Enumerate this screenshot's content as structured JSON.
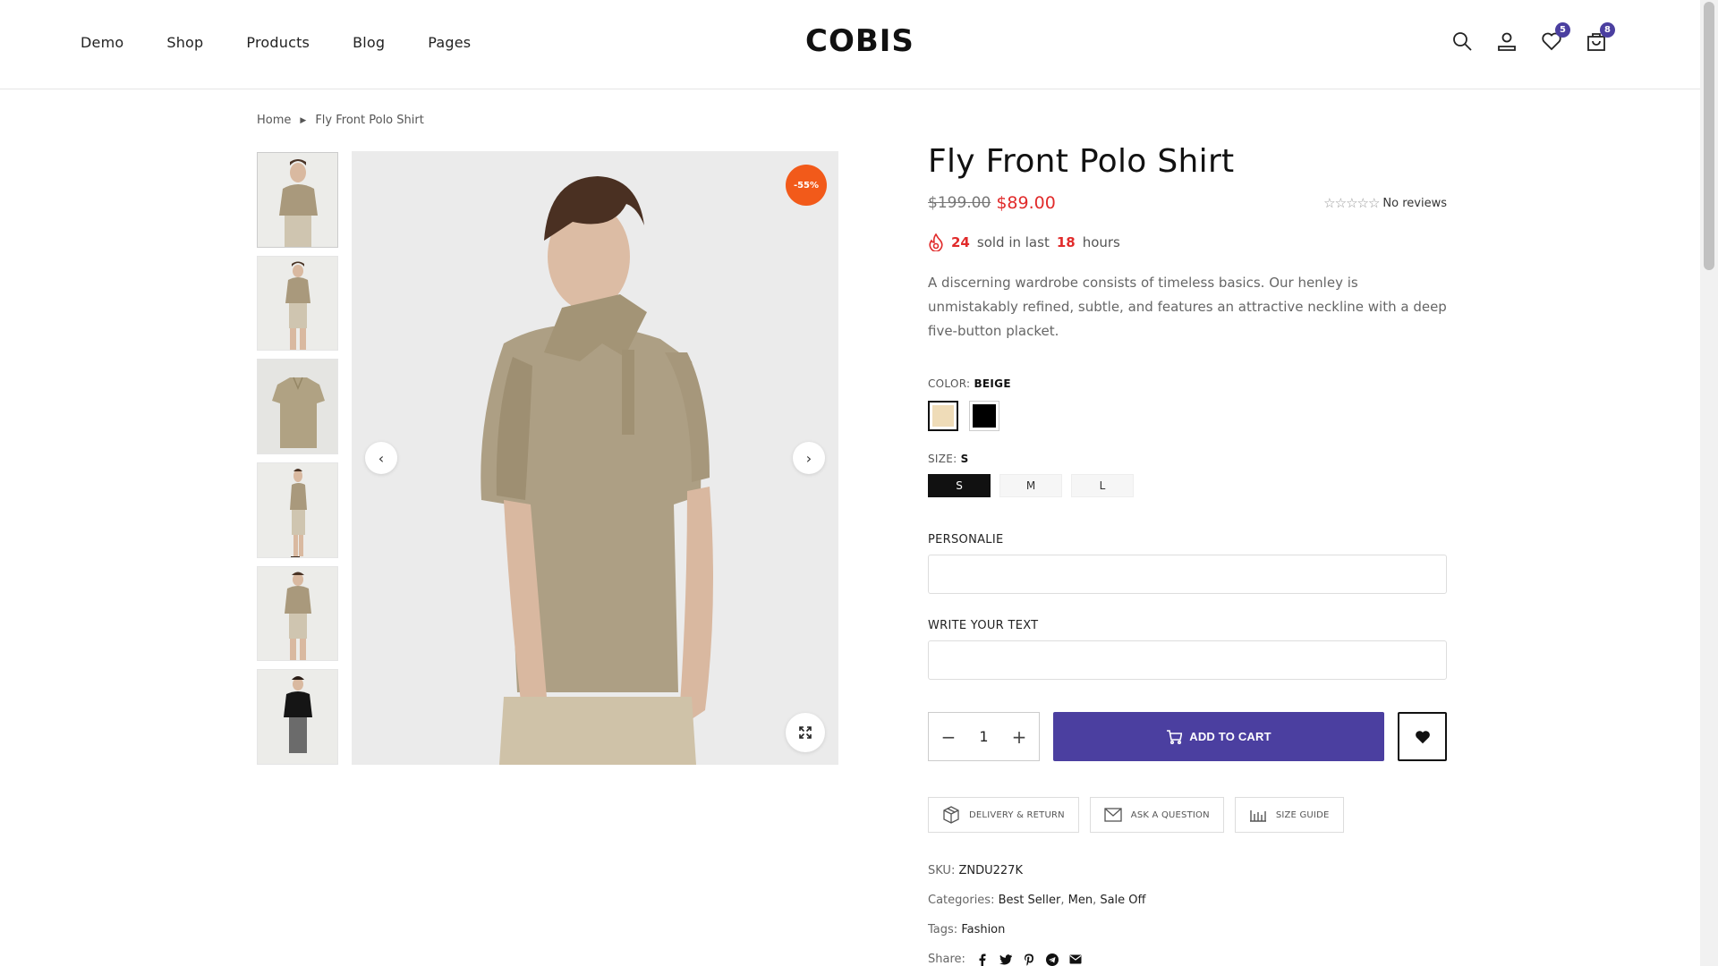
{
  "header": {
    "logo": "COBIS",
    "nav": [
      "Demo",
      "Shop",
      "Products",
      "Blog",
      "Pages"
    ],
    "wishlist_count": "5",
    "cart_count": "8"
  },
  "breadcrumb": {
    "home": "Home",
    "current": "Fly Front Polo Shirt"
  },
  "gallery": {
    "sale_badge": "-55%",
    "thumbnails": [
      "beige-front-half",
      "beige-front-full",
      "beige-flat",
      "beige-side",
      "beige-front-full-2",
      "black-front"
    ]
  },
  "product": {
    "title": "Fly Front Polo Shirt",
    "old_price": "$199.00",
    "new_price": "$89.00",
    "reviews_text": "No reviews",
    "rating": 0,
    "sold_count": "24",
    "sold_text": "sold in last",
    "sold_hours": "18",
    "hours_text": "hours",
    "description": "A discerning wardrobe consists of timeless basics. Our henley is unmistakably refined, subtle, and features an attractive neckline with a deep five-button placket.",
    "color_label": "COLOR:",
    "color_value": "BEIGE",
    "colors": [
      {
        "name": "beige",
        "hex": "#efdcb8"
      },
      {
        "name": "black",
        "hex": "#000000"
      }
    ],
    "size_label": "SIZE:",
    "size_value": "S",
    "sizes": [
      "S",
      "M",
      "L"
    ],
    "field1_label": "PERSONALIE",
    "field2_label": "WRITE YOUR TEXT",
    "quantity": "1",
    "add_to_cart": "ADD TO CART",
    "delivery_return": "DELIVERY & RETURN",
    "ask_question": "ASK A QUESTION",
    "size_guide": "SIZE GUIDE",
    "sku_label": "SKU:",
    "sku": "ZNDU227K",
    "categories_label": "Categories:",
    "categories": [
      "Best Seller",
      "Men",
      "Sale Off"
    ],
    "tags_label": "Tags:",
    "tags": "Fashion",
    "share_label": "Share:",
    "share_icons": [
      "facebook-icon",
      "twitter-icon",
      "pinterest-icon",
      "telegram-icon",
      "email-icon"
    ]
  },
  "colors": {
    "accent": "#4b3fa0",
    "sale": "#f25a1a",
    "price": "#e12b2b"
  }
}
